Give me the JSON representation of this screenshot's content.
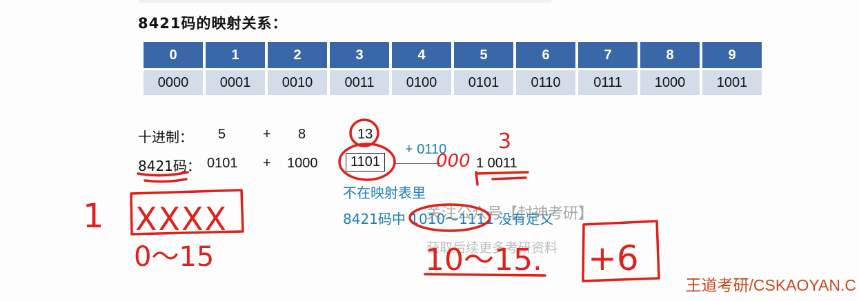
{
  "title": "8421码的映射关系：",
  "mapping_table": {
    "decimals": [
      "0",
      "1",
      "2",
      "3",
      "4",
      "5",
      "6",
      "7",
      "8",
      "9"
    ],
    "codes": [
      "0000",
      "0001",
      "0010",
      "0011",
      "0100",
      "0101",
      "0110",
      "0111",
      "1000",
      "1001"
    ]
  },
  "example": {
    "row1_label": "十进制：",
    "row1_a": "5",
    "row1_plus": "+",
    "row1_b": "8",
    "row1_result": "13",
    "row2_label": "8421码：",
    "row2_a": "0101",
    "row2_plus": "+",
    "row2_b": "1000",
    "row2_result": "1101",
    "correction": "+ 0110",
    "prefix_zeros": "000",
    "final_code": "1 0011",
    "note_line1": "不在映射表里",
    "note_line2": "8421码中 1010～1111 没有定义"
  },
  "handwriting": {
    "carry_digit": "3",
    "left_one": "1",
    "xxxx": "XXXX",
    "range_left": "0～15",
    "range_right": "10～15.",
    "plus_six": "+6"
  },
  "watermark": {
    "line1": "关注公众号【封神考研】",
    "line2": "获取后续更多考研资料"
  },
  "brand": "王道考研/CSKAOYAN.C",
  "colors": {
    "table_header": "#3a67a8",
    "table_body": "#d4dcea",
    "annotation_blue": "#1b7fb8",
    "ink_red": "#e0201a"
  }
}
